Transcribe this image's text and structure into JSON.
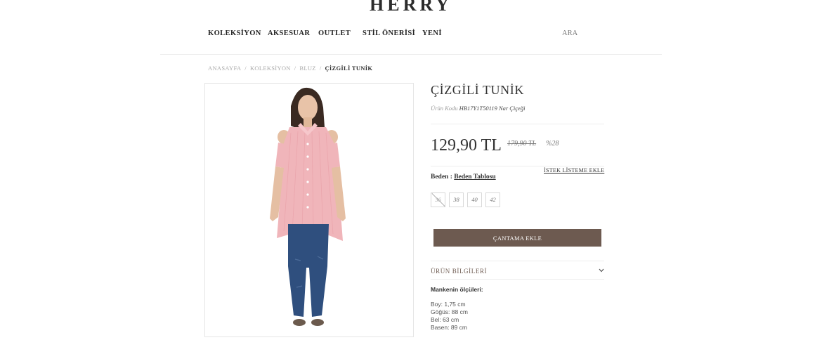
{
  "brand": "HERRY",
  "nav": {
    "items": [
      "KOLEKSİYON",
      "AKSESUAR",
      "OUTLET",
      "STİL ÖNERİSİ",
      "YENİ"
    ],
    "search_label": "ARA"
  },
  "breadcrumb": [
    "ANASAYFA",
    "KOLEKSİYON",
    "BLUZ",
    "ÇİZGİLİ TUNİK"
  ],
  "breadcrumb_sep": "/",
  "product": {
    "title": "ÇİZGİLİ TUNİK",
    "code_label": "Ürün Kodu",
    "code_value": "HB17Y1T50119 Nar Çiçeği",
    "price": "129,90 TL",
    "old_price": "179,90 TL",
    "discount": "%28",
    "size_label": "Beden :",
    "size_table_link": "Beden Tablosu",
    "wishlist_label": "İSTEK LİSTEME EKLE",
    "sizes": [
      {
        "label": "36",
        "available": false
      },
      {
        "label": "38",
        "available": true
      },
      {
        "label": "40",
        "available": true
      },
      {
        "label": "42",
        "available": true
      }
    ],
    "add_to_bag_label": "ÇANTAMA EKLE",
    "info_section_label": "ÜRÜN BİLGİLERİ",
    "model_title": "Mankenin ölçüleri:",
    "measurements": [
      "Boy: 1,75 cm",
      "Göğüs: 88 cm",
      "Bel: 63 cm",
      "Basen: 89 cm"
    ]
  },
  "colors": {
    "accent_brown": "#6d5a50",
    "shirt_pink": "#f0b5ba",
    "jeans_blue": "#2f4f7e"
  }
}
